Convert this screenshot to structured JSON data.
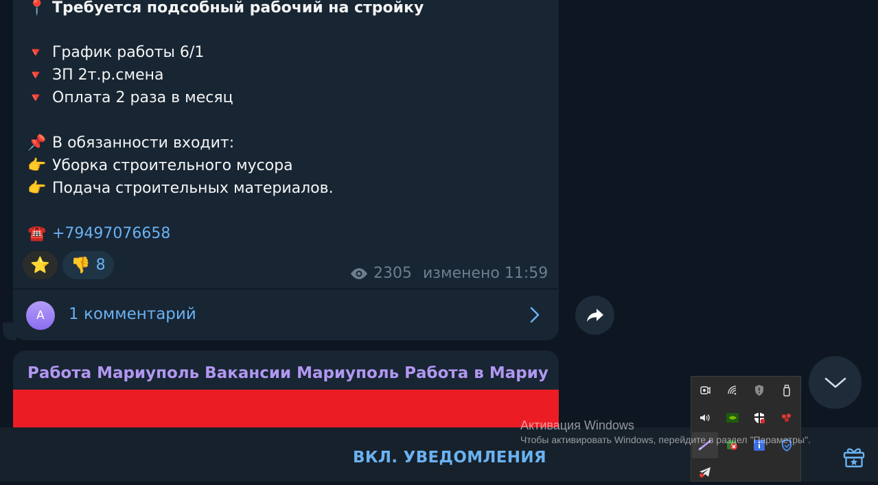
{
  "post": {
    "title_emoji": "📍",
    "title": "Требуется подсобный рабочий на стройку",
    "bullet_emoji": "🔻",
    "bullets": [
      "График работы 6/1",
      "ЗП 2т.р.смена",
      "Оплата 2 раза в месяц"
    ],
    "duties_emoji": "📌",
    "duties_heading": "В обязанности входит:",
    "duty_emoji": "👉",
    "duties": [
      "Уборка строительного мусора",
      "Подача строительных материалов."
    ],
    "phone_emoji": "☎️",
    "phone": "+79497076658",
    "reactions": [
      {
        "emoji": "⭐",
        "count": ""
      },
      {
        "emoji": "👎",
        "count": "8"
      }
    ],
    "views": "2305",
    "edited": "изменено 11:59",
    "comments": {
      "avatar_letter": "A",
      "label": "1 комментарий"
    }
  },
  "next_post": {
    "title": "Работа Мариуполь Вакансии Мариуполь Работа в Мариупо..."
  },
  "bottom_bar": {
    "notify_label": "ВКЛ. УВЕДОМЛЕНИЯ"
  },
  "watermark": {
    "title": "Активация Windows",
    "subtitle": "Чтобы активировать Windows, перейдите в раздел \"Параметры\"."
  },
  "tray_icons": [
    "meet-now-icon",
    "network-icon",
    "security-shield-icon",
    "usb-eject-icon",
    "volume-icon",
    "nvidia-icon",
    "antivirus-icon",
    "app-tray-icon",
    "pen-icon",
    "error-app-icon",
    "info-icon",
    "vpn-shield-icon",
    "telegram-icon"
  ],
  "colors": {
    "accent": "#6ab2f2",
    "channel_name": "#b197f0",
    "bubble": "#182533",
    "background": "#0e1621",
    "red_banner": "#ec1c24"
  }
}
